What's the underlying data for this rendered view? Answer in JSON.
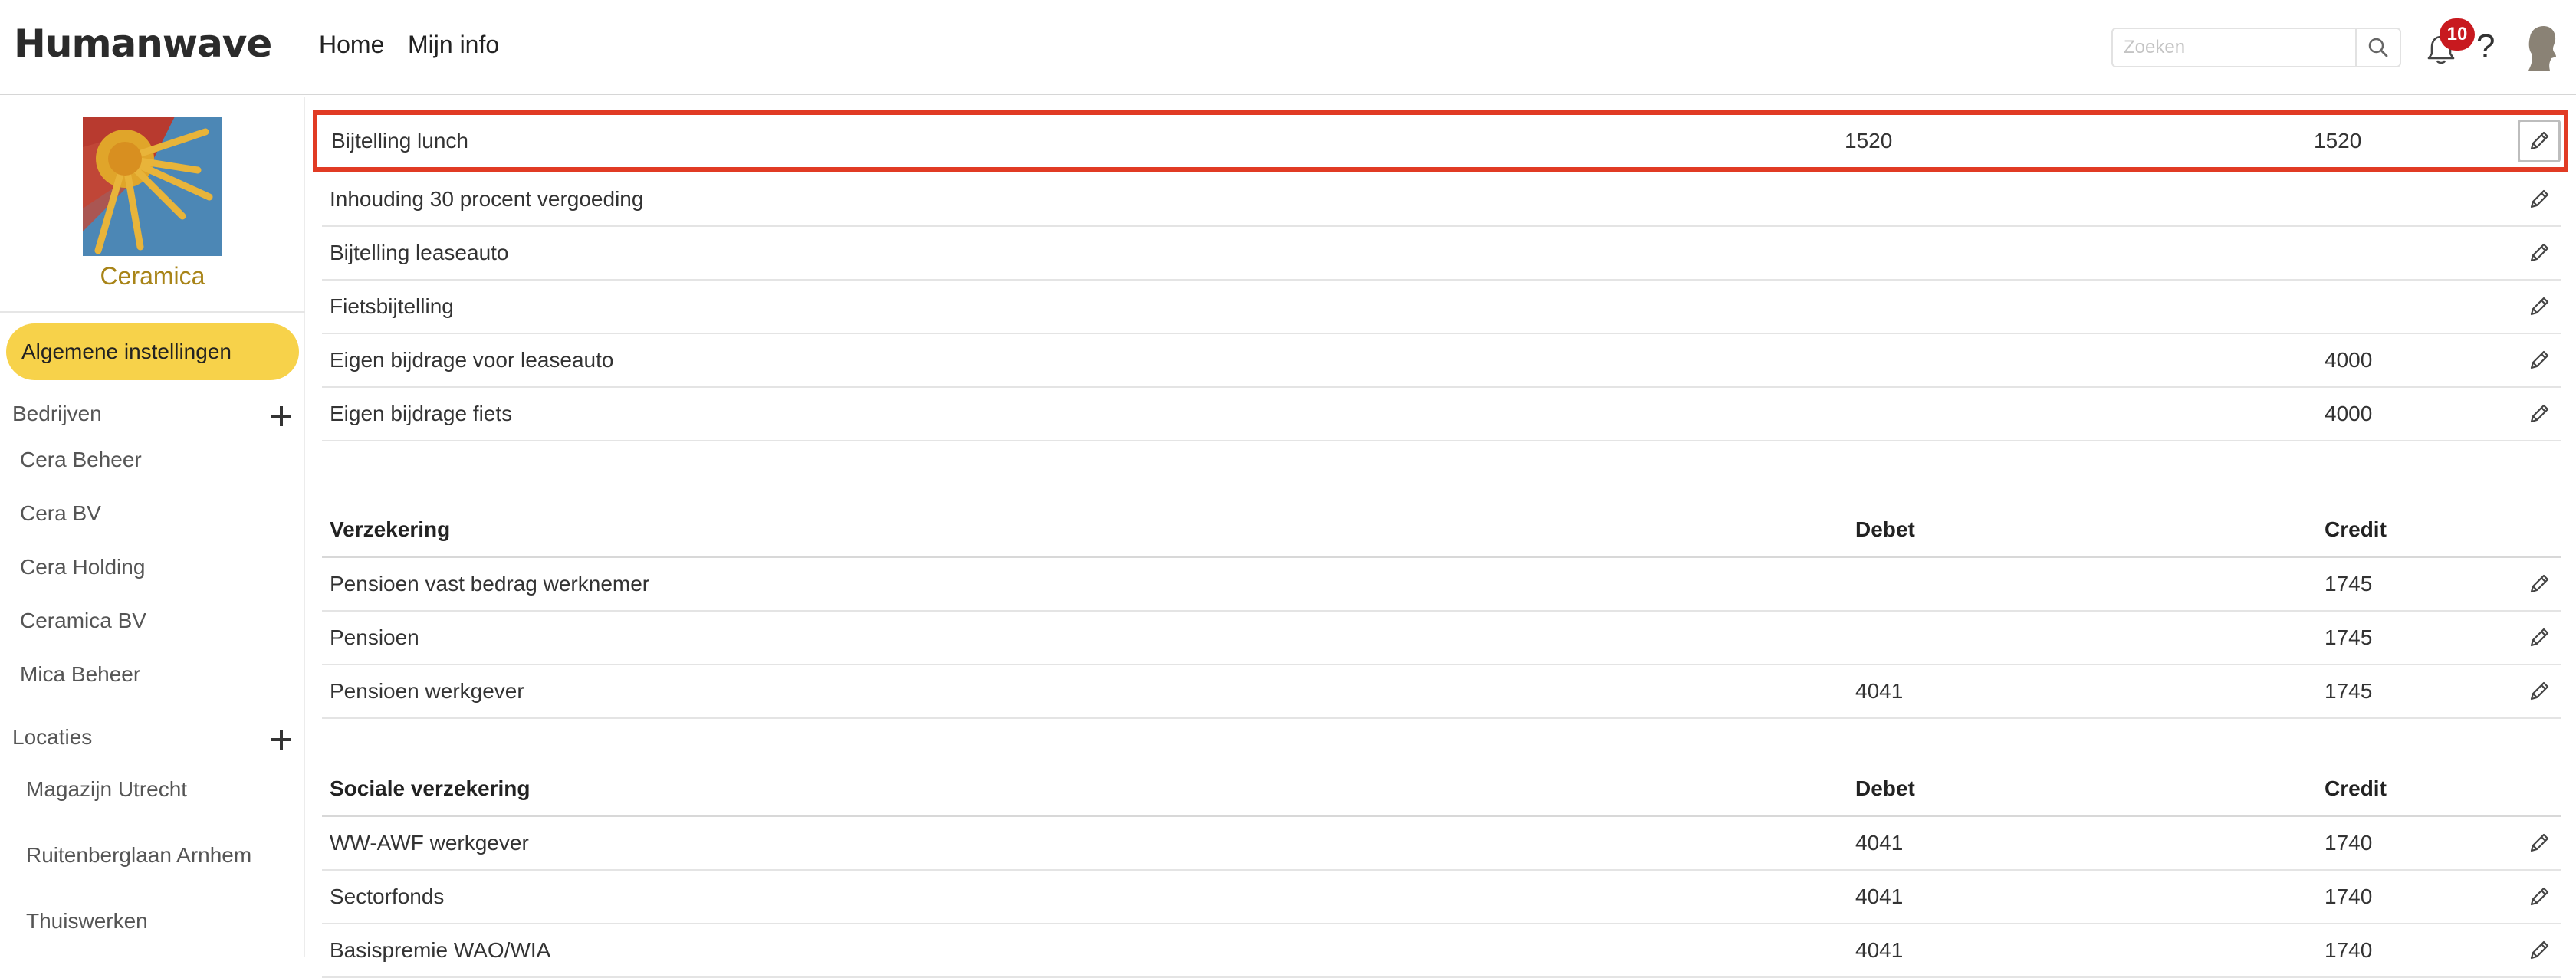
{
  "header": {
    "logo": "Humanwave",
    "nav": [
      "Home",
      "Mijn info"
    ],
    "search_placeholder": "Zoeken",
    "notification_count": "10",
    "help_label": "?"
  },
  "sidebar": {
    "company_name": "Ceramica",
    "general_settings_label": "Algemene instellingen",
    "companies_title": "Bedrijven",
    "companies": [
      "Cera Beheer",
      "Cera BV",
      "Cera Holding",
      "Ceramica BV",
      "Mica Beheer"
    ],
    "locations_title": "Locaties",
    "locations": [
      "Magazijn Utrecht",
      "Ruitenberglaan Arnhem",
      "Thuiswerken"
    ]
  },
  "main": {
    "top_rows": [
      {
        "name": "Bijtelling lunch",
        "debet": "1520",
        "credit": "1520"
      },
      {
        "name": "Inhouding 30 procent vergoeding",
        "debet": "",
        "credit": ""
      },
      {
        "name": "Bijtelling leaseauto",
        "debet": "",
        "credit": ""
      },
      {
        "name": "Fietsbijtelling",
        "debet": "",
        "credit": ""
      },
      {
        "name": "Eigen bijdrage voor leaseauto",
        "debet": "",
        "credit": "4000"
      },
      {
        "name": "Eigen bijdrage fiets",
        "debet": "",
        "credit": "4000"
      }
    ],
    "insurance": {
      "headers": {
        "name": "Verzekering",
        "debet": "Debet",
        "credit": "Credit"
      },
      "rows": [
        {
          "name": "Pensioen vast bedrag werknemer",
          "debet": "",
          "credit": "1745"
        },
        {
          "name": "Pensioen",
          "debet": "",
          "credit": "1745"
        },
        {
          "name": "Pensioen werkgever",
          "debet": "4041",
          "credit": "1745"
        }
      ]
    },
    "social": {
      "headers": {
        "name": "Sociale verzekering",
        "debet": "Debet",
        "credit": "Credit"
      },
      "rows": [
        {
          "name": "WW-AWF werkgever",
          "debet": "4041",
          "credit": "1740"
        },
        {
          "name": "Sectorfonds",
          "debet": "4041",
          "credit": "1740"
        },
        {
          "name": "Basispremie WAO/WIA",
          "debet": "4041",
          "credit": "1740"
        }
      ]
    }
  },
  "colors": {
    "accent_yellow": "#f7d24a",
    "highlight_red": "#e13b24",
    "badge_red": "#c8191f",
    "company_gold": "#a88418"
  }
}
